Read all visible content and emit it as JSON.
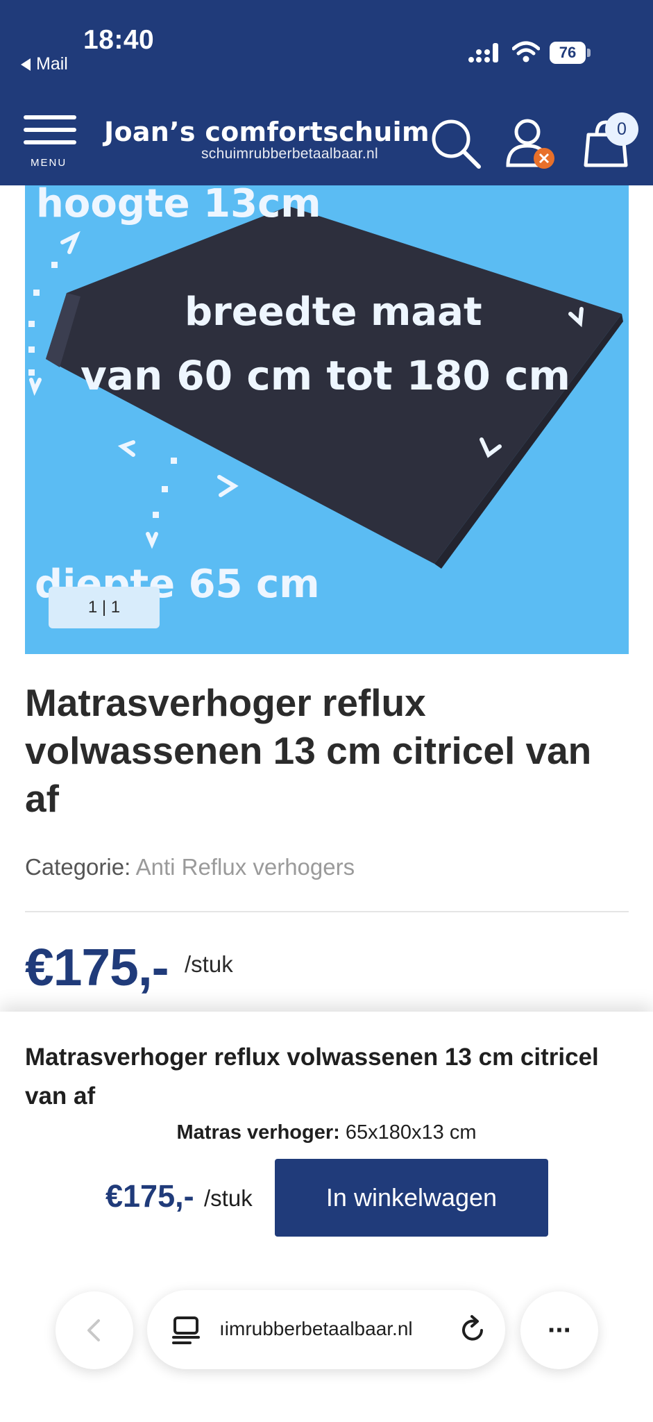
{
  "status_bar": {
    "time": "18:40",
    "back_app": "Mail",
    "battery": "76"
  },
  "header": {
    "menu_label": "MENU",
    "brand_title": "Joan’s comfortschuim",
    "brand_subtitle": "schuimrubberbetaalbaar.nl",
    "cart_count": "0",
    "colors": {
      "background": "#203b7a",
      "badge": "#e8702a"
    }
  },
  "gallery": {
    "image_text": {
      "height": "hoogte 13cm",
      "width_line1": "breedte maat",
      "width_line2": "van 60 cm tot 180 cm",
      "depth": "diepte 65 cm"
    },
    "counter": "1 | 1",
    "colors": {
      "background": "#5bbcf3",
      "product": "#2d2f3d"
    }
  },
  "product": {
    "title": "Matrasverhoger reflux volwassenen 13 cm citricel van af",
    "category_label": "Categorie:",
    "category_link": "Anti Reflux verhogers",
    "price": "€175,-",
    "price_unit": "/stuk"
  },
  "sticky": {
    "title": "Matrasverhoger reflux volwassenen 13 cm citricel van af",
    "variant_label": "Matras verhoger:",
    "variant_value": "65x180x13 cm",
    "price": "€175,-",
    "price_unit": "/stuk",
    "add_to_cart": "In winkelwagen"
  },
  "browser": {
    "url": "ıimrubberbetaalbaar.nl",
    "more": "···"
  }
}
